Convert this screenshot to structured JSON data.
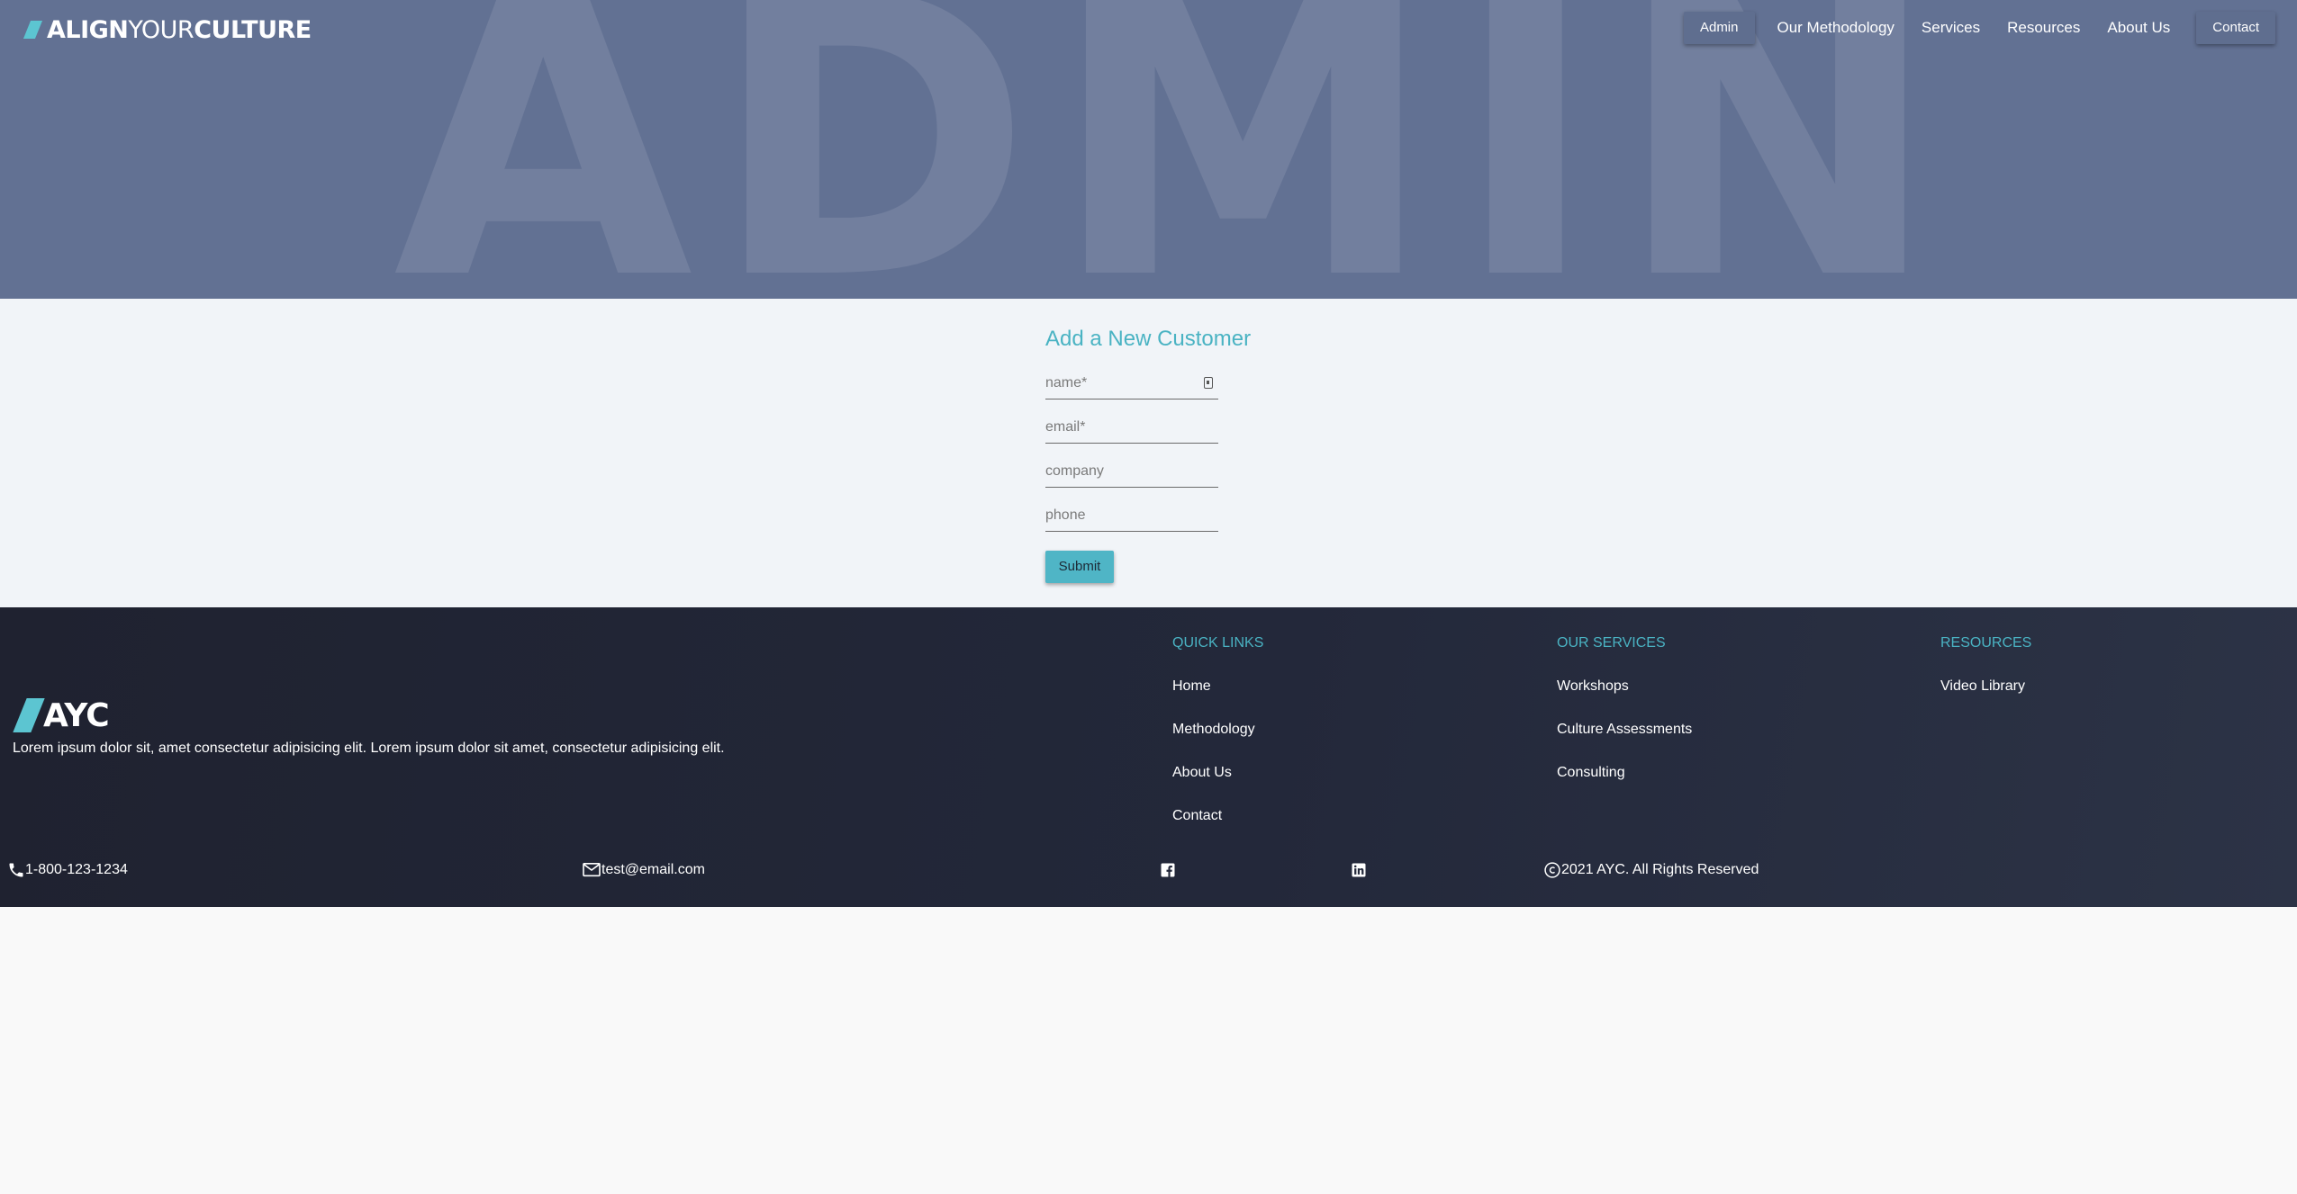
{
  "header": {
    "logo_bold": "ALIGN",
    "logo_light": "YOUR",
    "logo_bold2": "CULTURE",
    "watermark": "ADMIN",
    "nav": [
      "Admin",
      "Our Methodology",
      "Services",
      "Resources",
      "About Us",
      "Contact"
    ]
  },
  "form": {
    "title": "Add a New Customer",
    "fields": {
      "name": {
        "placeholder": "name*",
        "value": ""
      },
      "email": {
        "placeholder": "email*",
        "value": ""
      },
      "company": {
        "placeholder": "company",
        "value": ""
      },
      "phone": {
        "placeholder": "phone",
        "value": ""
      }
    },
    "submit_label": "Submit"
  },
  "footer": {
    "logo_text": "AYC",
    "description": "Lorem ipsum dolor sit, amet consectetur adipisicing elit. Lorem ipsum dolor sit amet, consectetur adipisicing elit.",
    "quick_links": {
      "title": "QUICK LINKS",
      "items": [
        "Home",
        "Methodology",
        "About Us",
        "Contact"
      ]
    },
    "services": {
      "title": "OUR SERVICES",
      "items": [
        "Workshops",
        "Culture Assessments",
        "Consulting"
      ]
    },
    "resources": {
      "title": "RESOURCES",
      "items": [
        "Video Library"
      ]
    },
    "phone": "1-800-123-1234",
    "email": "test@email.com",
    "copyright": "2021 AYC. All Rights Reserved",
    "social_icons": [
      "facebook-icon",
      "linkedin-icon"
    ]
  },
  "colors": {
    "hero_bg": "#627193",
    "accent": "#4ab3c3",
    "footer_bg": "#23283a",
    "form_bg": "#f1f4f8"
  }
}
